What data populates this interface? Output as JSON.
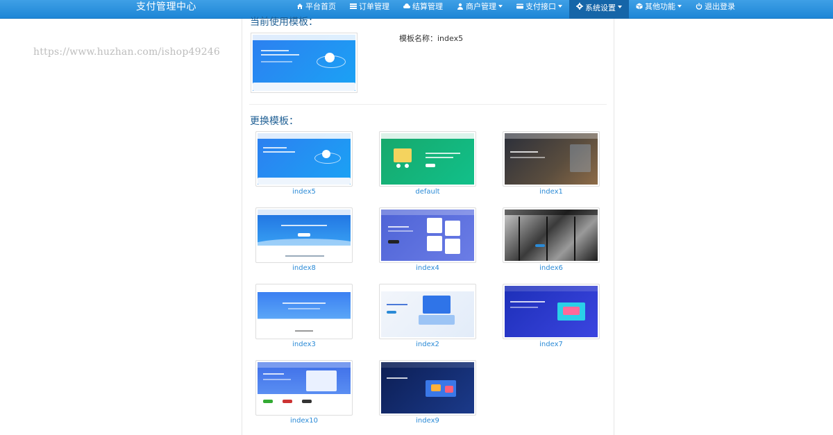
{
  "brand": "支付管理中心",
  "nav": [
    {
      "label": "平台首页",
      "icon": "home-icon"
    },
    {
      "label": "订单管理",
      "icon": "list-icon"
    },
    {
      "label": "结算管理",
      "icon": "cloud-icon"
    },
    {
      "label": "商户管理",
      "icon": "user-icon",
      "dropdown": true
    },
    {
      "label": "支付接口",
      "icon": "card-icon",
      "dropdown": true
    },
    {
      "label": "系统设置",
      "icon": "gear-icon",
      "dropdown": true,
      "active": true
    },
    {
      "label": "其他功能",
      "icon": "cube-icon",
      "dropdown": true
    },
    {
      "label": "退出登录",
      "icon": "power-icon"
    }
  ],
  "watermark": "https://www.huzhan.com/ishop49246",
  "current": {
    "title": "当前使用模板：",
    "name_label": "模板名称：index5"
  },
  "change_title": "更换模板：",
  "templates": [
    {
      "name": "index5",
      "style": "blue-orbit"
    },
    {
      "name": "default",
      "style": "green-cart"
    },
    {
      "name": "index1",
      "style": "city-dark"
    },
    {
      "name": "index8",
      "style": "blue-wave"
    },
    {
      "name": "index4",
      "style": "purple-cards"
    },
    {
      "name": "index6",
      "style": "mono-window"
    },
    {
      "name": "index3",
      "style": "banner-blue"
    },
    {
      "name": "index2",
      "style": "iso-server"
    },
    {
      "name": "index7",
      "style": "deep-blue-iso"
    },
    {
      "name": "index10",
      "style": "white-laptop"
    },
    {
      "name": "index9",
      "style": "navy-iso"
    }
  ],
  "colors": {
    "nav_top": "#3fa0e6",
    "nav_bottom": "#1d86d6",
    "link": "#2a8ad6",
    "title": "#1f5f94"
  }
}
